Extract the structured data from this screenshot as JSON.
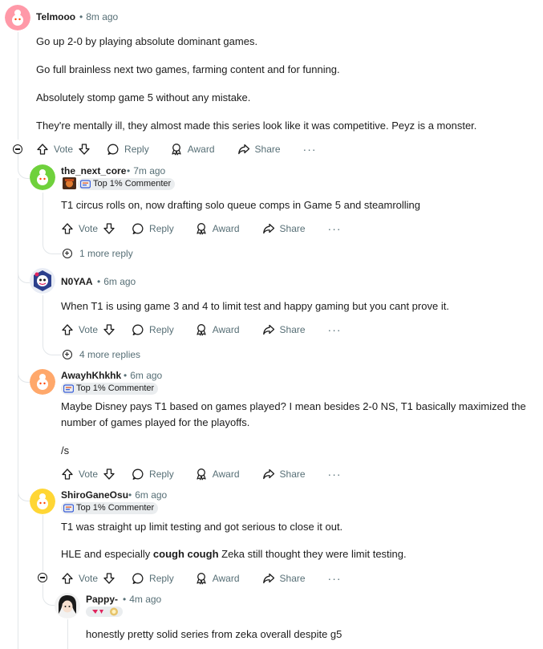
{
  "actions": {
    "vote": "Vote",
    "reply": "Reply",
    "award": "Award",
    "share": "Share",
    "more": "···"
  },
  "comments": [
    {
      "username": "Telmooo",
      "time": "8m ago",
      "paragraphs": [
        "Go up 2-0 by playing absolute dominant games.",
        "Go full brainless next two games, farming content and for funning.",
        "Absolutely stomp game 5 without any mistake.",
        "They're mentally ill, they almost made this series look like it was competitive. Peyz is a monster."
      ]
    },
    {
      "username": "the_next_core",
      "time": "7m ago",
      "flair": "Top 1% Commenter",
      "paragraphs": [
        "T1 circus rolls on, now drafting solo queue comps in Game 5 and steamrolling"
      ],
      "more_replies": "1 more reply"
    },
    {
      "username": "N0YAA",
      "time": "6m ago",
      "paragraphs": [
        "When T1 is using game 3 and 4 to limit test and happy gaming but you cant prove it."
      ],
      "more_replies": "4 more replies"
    },
    {
      "username": "AwayhKhkhk",
      "time": "6m ago",
      "flair": "Top 1% Commenter",
      "paragraphs": [
        "Maybe Disney pays T1 based on games played? I mean besides 2-0 NS, T1 basically maximized the",
        "number of games played for the playoffs.",
        "/s"
      ]
    },
    {
      "username": "ShiroGaneOsu",
      "time": "6m ago",
      "flair": "Top 1% Commenter",
      "paragraphs": [
        "T1 was straight up limit testing and got serious to close it out."
      ],
      "p2_before": "HLE and especially ",
      "p2_bold": "cough cough",
      "p2_after": " Zeka still thought they were limit testing."
    },
    {
      "username": "Pappy-",
      "time": "4m ago",
      "paragraphs": [
        "honestly pretty solid series from zeka overall despite g5"
      ]
    }
  ],
  "colors": {
    "text": "#1c1c1c",
    "meta": "#576f76",
    "flair_bg": "#eaedef",
    "thread": "#e2e6e9"
  }
}
